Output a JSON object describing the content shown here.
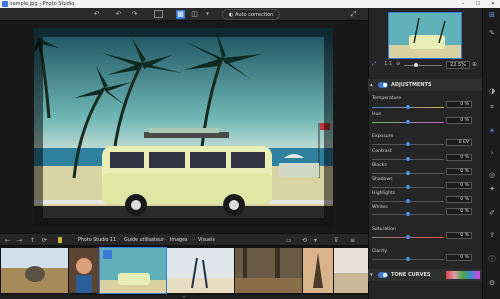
{
  "titlebar": {
    "title": "sample.jpg - Photo Studio",
    "minimize": "–",
    "maximize": "☐",
    "close": "✕"
  },
  "toolbar": {
    "auto_correction_label": "Auto correction"
  },
  "panel": {
    "zoom_value": "22.5%",
    "adjustments_title": "ADJUSTMENTS",
    "tone_curves_title": "TONE CURVES",
    "controls": [
      {
        "label": "Temperature",
        "value": "0 %"
      },
      {
        "label": "Hue",
        "value": "0 %"
      },
      {
        "label": "Exposure",
        "value": "0 EV"
      },
      {
        "label": "Contrast",
        "value": "0 %"
      },
      {
        "label": "Blacks",
        "value": "0 %"
      },
      {
        "label": "Shadows",
        "value": "0 %"
      },
      {
        "label": "Highlights",
        "value": "0 %"
      },
      {
        "label": "Whites",
        "value": "0 %"
      },
      {
        "label": "Saturation",
        "value": "0 %"
      },
      {
        "label": "Clarity",
        "value": "0 %"
      }
    ]
  },
  "breadcrumb": [
    "Photo Studio 11",
    "Guide utilisateur",
    "Images",
    "Visuels"
  ],
  "icons": {
    "back": "←",
    "forward": "→",
    "up": "↑",
    "refresh": "⟳",
    "undo": "↶",
    "redo": "↷",
    "grid": "▦",
    "split": "◫",
    "expand": "⤢",
    "menu": "≡"
  },
  "colors": {
    "accent": "#3b7ad6",
    "panel": "#252525",
    "background": "#1e1e1e"
  }
}
